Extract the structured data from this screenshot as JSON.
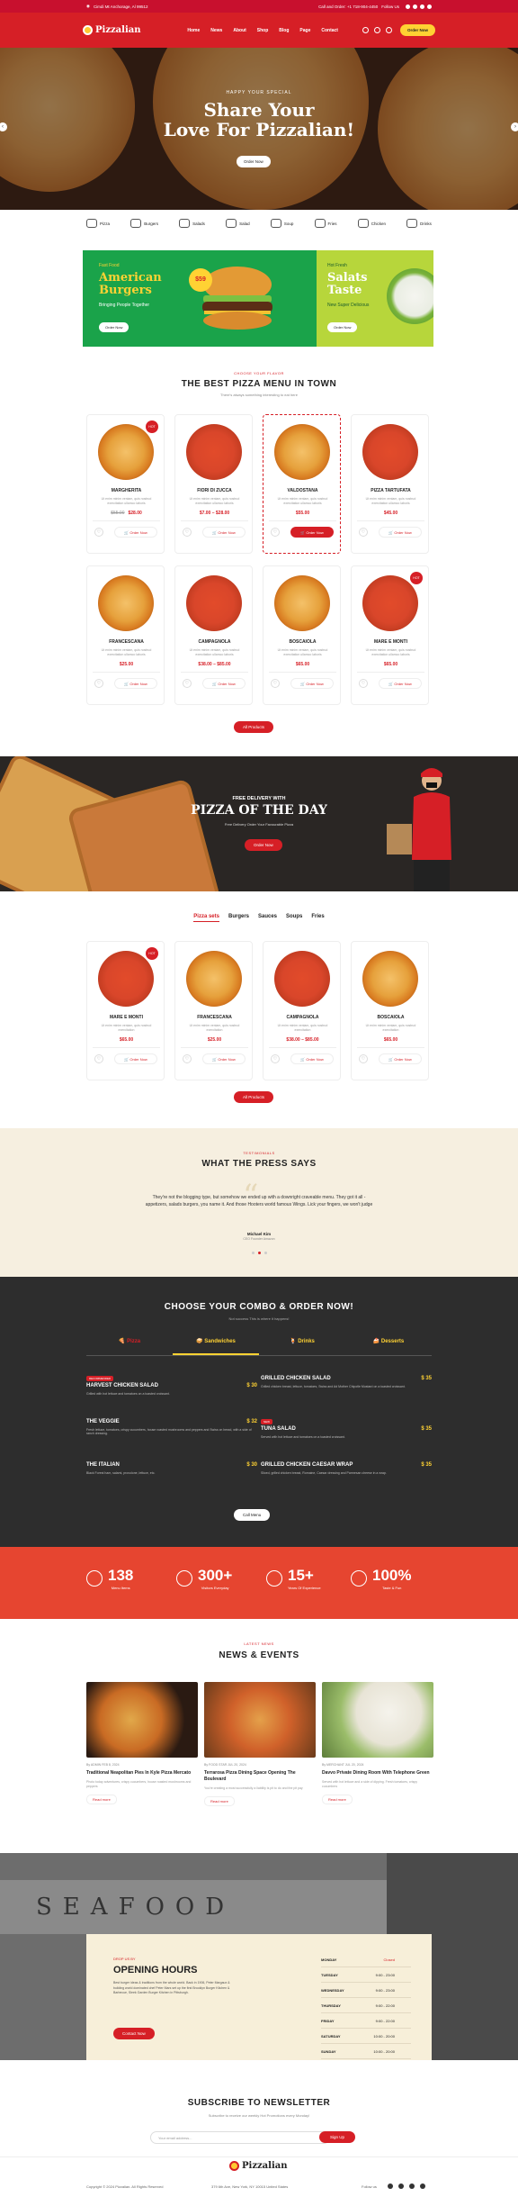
{
  "topbar": {
    "address": "Cimdi Mt Anchorage, Al 99512",
    "call": "Call and Order: +1 718-904-4450",
    "follow": "Follow Us"
  },
  "nav": {
    "logo": "Pizzalian",
    "menu": [
      "Home",
      "News",
      "About",
      "Shop",
      "Blog",
      "Page",
      "Contact"
    ],
    "order": "Order Now"
  },
  "hero": {
    "sub": "HAPPY YOUR SPECIAL",
    "title1": "Share Your",
    "title2": "Love For Pizzalian!",
    "btn": "Order Now"
  },
  "categories": [
    "Pizza",
    "Burgers",
    "Salads",
    "Salad",
    "Soup",
    "Fries",
    "Chicken",
    "Drinks"
  ],
  "banner1": {
    "tag": "Fast Food",
    "t1": "American",
    "t2": "Burgers",
    "sub": "Bringing People Together",
    "btn": "Order Now",
    "price": "$59"
  },
  "banner2": {
    "tag": "Hot Fresh",
    "t1": "Salats",
    "t2": "Taste",
    "sub": "New Super Delicious",
    "btn": "Order Now"
  },
  "menu": {
    "sub": "CHOOSE YOUR FLAVOR",
    "title": "THE BEST PIZZA MENU IN TOWN",
    "desc": "There's always something interesting to eat here",
    "items": [
      {
        "name": "MARGHERITA",
        "desc": "Ut enim minim veniam, quis nostrud exercitation ullamco laboris",
        "old": "$55.00",
        "price": "$28.00",
        "hot": "HOT",
        "order": "Order Now"
      },
      {
        "name": "FIORI DI ZUCCA",
        "desc": "Ut enim minim veniam, quis nostrud exercitation ullamco laboris",
        "old": "",
        "price": "$7.00 – $28.00",
        "hot": "",
        "order": "Order Now"
      },
      {
        "name": "VALDOSTANA",
        "desc": "Ut enim minim veniam, quis nostrud exercitation ullamco laboris",
        "old": "",
        "price": "$55.00",
        "hot": "",
        "order": "Order Now"
      },
      {
        "name": "PIZZA TARTUFATA",
        "desc": "Ut enim minim veniam, quis nostrud exercitation ullamco laboris",
        "old": "",
        "price": "$45.00",
        "hot": "",
        "order": "Order Now"
      },
      {
        "name": "FRANCESCANA",
        "desc": "Ut enim minim veniam, quis nostrud exercitation ullamco laboris",
        "old": "",
        "price": "$25.00",
        "hot": "",
        "order": "Order Now"
      },
      {
        "name": "CAMPAGNOLA",
        "desc": "Ut enim minim veniam, quis nostrud exercitation ullamco laboris",
        "old": "",
        "price": "$38.00 – $85.00",
        "hot": "",
        "order": "Order Now"
      },
      {
        "name": "BOSCAIOLA",
        "desc": "Ut enim minim veniam, quis nostrud exercitation ullamco laboris",
        "old": "",
        "price": "$65.00",
        "hot": "",
        "order": "Order Now"
      },
      {
        "name": "MARE E MONTI",
        "desc": "Ut enim minim veniam, quis nostrud exercitation ullamco laboris",
        "old": "",
        "price": "$65.00",
        "hot": "HOT",
        "order": "Order Now"
      }
    ],
    "all": "All Products"
  },
  "promo": {
    "t1": "FREE DELIVERY WITH",
    "t2": "PIZZA OF THE DAY",
    "t3": "Free Delivery Order Your Favourable Pizza",
    "btn": "Order Now"
  },
  "tabs": [
    "Pizza sets",
    "Burgers",
    "Sauces",
    "Soups",
    "Fries"
  ],
  "sets": [
    {
      "name": "MARE E MONTI",
      "desc": "Ut enim minim veniam, quis nostrud exercitation",
      "price": "$65.00",
      "hot": "HOT",
      "order": "Order Now"
    },
    {
      "name": "FRANCESCANA",
      "desc": "Ut enim minim veniam, quis nostrud exercitation",
      "price": "$25.00",
      "hot": "",
      "order": "Order Now"
    },
    {
      "name": "CAMPAGNOLA",
      "desc": "Ut enim minim veniam, quis nostrud exercitation",
      "price": "$38.00 – $85.00",
      "hot": "",
      "order": "Order Now"
    },
    {
      "name": "BOSCAIOLA",
      "desc": "Ut enim minim veniam, quis nostrud exercitation",
      "price": "$65.00",
      "hot": "",
      "order": "Order Now"
    }
  ],
  "sets_all": "All Products",
  "press": {
    "sub": "TESTIMONIALS",
    "title": "WHAT THE PRESS SAYS",
    "quote": "They're not the blogging type, but somehow we ended up with a downright craveable menu. They got it all - appetizers, salads burgers, you name it. And those Hooters world famous Wings. Lick your fingers, we won't judge",
    "author": "Michael Kim",
    "role": "CEO Founder Amazon"
  },
  "combo": {
    "title": "CHOOSE YOUR COMBO & ORDER NOW!",
    "desc": "Not success This is where it happens!",
    "tabs": [
      "Pizza",
      "Sandwiches",
      "Drinks",
      "Desserts"
    ],
    "items": [
      {
        "name": "HARVEST CHICKEN SALAD",
        "price": "$ 30",
        "tag": "RECOMMENDED",
        "desc": "Grilled with hot lettuce and tomatoes on a toasted croissant."
      },
      {
        "name": "GRILLED CHICKEN SALAD",
        "price": "$ 35",
        "tag": "",
        "desc": "Grilled chicken breast, lettuce, tomatoes, Swiss and Ad Mother Chipotle Mustard on a toasted croissant."
      },
      {
        "name": "THE VEGGIE",
        "price": "$ 32",
        "tag": "",
        "desc": "Fresh lettuce, tomatoes, crispy cucumbers, house roasted mushrooms and peppers and Swiss on bread, with a side of ranch dressing."
      },
      {
        "name": "TUNA SALAD",
        "price": "$ 35",
        "tag": "NEW",
        "desc": "Served with hot lettuce and tomatoes on a toasted croissant."
      },
      {
        "name": "THE ITALIAN",
        "price": "$ 30",
        "tag": "",
        "desc": "Black Forest ham, salami, provolone, lettuce, etc."
      },
      {
        "name": "GRILLED CHICKEN CAESAR WRAP",
        "price": "$ 35",
        "tag": "",
        "desc": "Sliced, grilled chicken breast, Romaine, Caesar dressing and Parmesan cheese in a wrap."
      }
    ],
    "btn": "Call Menu"
  },
  "stats": [
    {
      "v": "138",
      "l": "Menu Items"
    },
    {
      "v": "300+",
      "l": "Visitors Everyday"
    },
    {
      "v": "15+",
      "l": "Years Of Experience"
    },
    {
      "v": "100%",
      "l": "Taste & Fun"
    }
  ],
  "news": {
    "sub": "LATEST NEWS",
    "title": "NEWS & EVENTS",
    "items": [
      {
        "meta": "By ADMIN    FEB 8, 2024",
        "title": "Traditional Neapolitan Pies In Kyle Pizza Mercato",
        "desc": "Photo today adventures, crispy cucumbers, house roasted mushrooms and peppers",
        "more": "Read more"
      },
      {
        "meta": "By FOOD STAR    JUL 20, 2024",
        "title": "Terrarosa Pizza Dining Space Opening The Boulevard",
        "desc": "You're creating a most successfully a liability is pit to do and the pit pay",
        "more": "Read more"
      },
      {
        "meta": "By MERCHANT    JUL 20, 2024",
        "title": "Davvo Private Dining Room With Telephone Green",
        "desc": "Served with hot lettuce and a side of dipping. Fresh tomatoes, crispy cucumbers",
        "more": "Read more"
      }
    ]
  },
  "seafood": "SEAFOOD",
  "hours": {
    "sub": "DROP US BY",
    "title": "OPENING HOURS",
    "desc": "Best burger ideas & traditions from the whole world. Back in 1906, Peter Margaux & building world dominated chef Peter Mars set up the first Brooklyn Burger Kitchen & Barbecue, Sleek Garden Burger Kitchen in Pittsburgh.",
    "btn": "Contact Now",
    "rows": [
      {
        "d": "MONDAY",
        "t": "Closed"
      },
      {
        "d": "TUESDAY",
        "t": "9:00 - 23:00"
      },
      {
        "d": "WEDNESDAY",
        "t": "9:00 - 23:00"
      },
      {
        "d": "THURSDAY",
        "t": "9:00 - 22:00"
      },
      {
        "d": "FRIDAY",
        "t": "9:00 - 22:00"
      },
      {
        "d": "SATURDAY",
        "t": "10:00 - 20:00"
      },
      {
        "d": "SUNDAY",
        "t": "10:00 - 20:00"
      }
    ]
  },
  "newsletter": {
    "title": "SUBSCRIBE TO NEWSLETTER",
    "desc": "Subscribe to receive our weekly Hot Promotions every Monday!",
    "placeholder": "Your email address...",
    "btn": "Sign Up"
  },
  "footer": {
    "logo": "Pizzalian",
    "copy": "Copyright © 2024 Pizzalian. All Rights Reserved",
    "address": "379 6th Ave, New York, NY 10015 United States",
    "follow": "Follow us"
  },
  "colors": {
    "primary": "#d61f26",
    "accent": "#ffd233",
    "green": "#1aa34a",
    "dark": "#2d2d2d"
  }
}
